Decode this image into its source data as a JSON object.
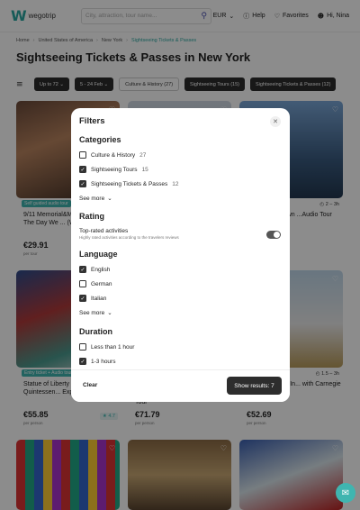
{
  "header": {
    "logo_text": "wegotrip",
    "search_placeholder": "City, attraction, tour name...",
    "currency": "EUR",
    "help": "Help",
    "favorites": "Favorites",
    "user": "Hi, Nina"
  },
  "breadcrumbs": [
    "Home",
    "United States of America",
    "New York",
    "Sightseeing Tickets & Passes"
  ],
  "page_title": "Sightseeing Tickets & Passes in New York",
  "filters_bar": {
    "price": "Up to 72",
    "dates": "5 - 24 Feb",
    "chips": [
      "Culture & History (27)",
      "Sightseeing Tours (15)",
      "Sightseeing Tickets & Passes (12)"
    ]
  },
  "cards": [
    {
      "badge": "Self guided audio tour",
      "title": "9/11 Memorial&Museum Tour: The Day We ... (Without A Ticket)",
      "price": "€29.91",
      "per": "per tour"
    },
    {
      "title": "",
      "price": "",
      "per": ""
    },
    {
      "duration": "2 – 3h",
      "title": "...ding & Midtown ...Audio Tour",
      "price": "",
      "per": ""
    },
    {
      "badge": "Entry ticket + Audio tour",
      "title": "Statue of Liberty & ... Tour: A Quintessen... Experience",
      "price": "€55.85",
      "per": "per person",
      "rating": "4.7"
    },
    {
      "title": "Tour",
      "price": "€71.79",
      "per": "per person"
    },
    {
      "duration": "1.5 – 3h",
      "title": "...eum Ticket & In... with Carnegie Hill Walk",
      "price": "€52.69",
      "per": "per person"
    }
  ],
  "modal": {
    "title": "Filters",
    "categories": {
      "heading": "Categories",
      "options": [
        {
          "label": "Culture & History",
          "count": "27",
          "checked": false
        },
        {
          "label": "Sightseeing Tours",
          "count": "15",
          "checked": true
        },
        {
          "label": "Sightseeing Tickets & Passes",
          "count": "12",
          "checked": true
        }
      ],
      "see_more": "See more"
    },
    "rating": {
      "heading": "Rating",
      "option": "Top-rated activities",
      "desc": "Highly rated activities according to the travelers reviews"
    },
    "language": {
      "heading": "Language",
      "options": [
        {
          "label": "English",
          "checked": true
        },
        {
          "label": "German",
          "checked": false
        },
        {
          "label": "Italian",
          "checked": true
        }
      ],
      "see_more": "See more"
    },
    "duration": {
      "heading": "Duration",
      "options": [
        {
          "label": "Less than 1 hour",
          "checked": false
        },
        {
          "label": "1-3 hours",
          "checked": true
        }
      ]
    },
    "clear": "Clear",
    "show_results": "Show results: 7"
  }
}
